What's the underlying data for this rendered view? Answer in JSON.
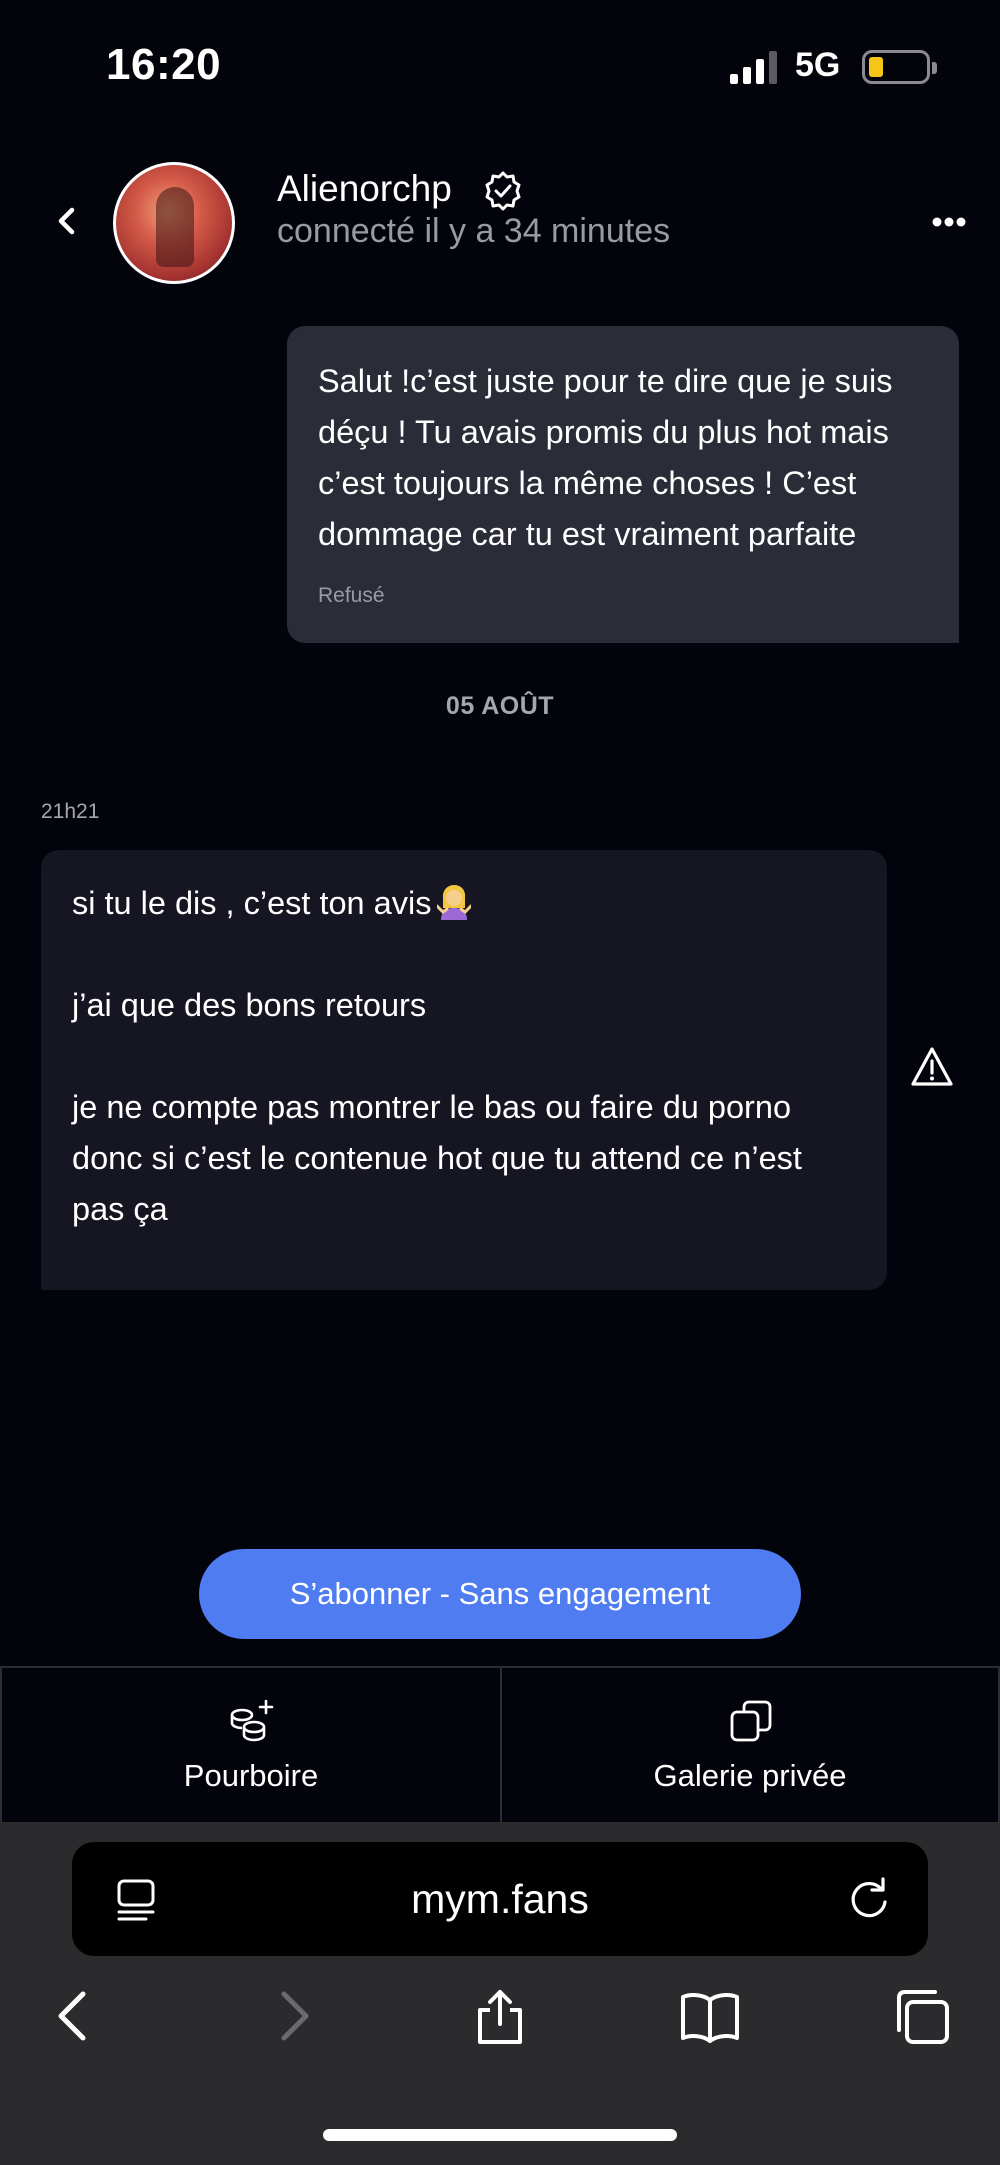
{
  "status_bar": {
    "time": "16:20",
    "network": "5G"
  },
  "header": {
    "username": "Alienorchp",
    "presence": "connecté il y a 34 minutes"
  },
  "messages": {
    "outgoing": {
      "text": "Salut !c’est juste pour te dire que je suis\ndéçu ! Tu avais promis du plus hot mais\nc’est toujours la même choses ! C’est\ndommage car tu est vraiment parfaite",
      "status": "Refusé"
    },
    "date_separator": "05 AOÛT",
    "incoming": {
      "time": "21h21",
      "line1": "si tu le dis , c’est ton avis",
      "line2": "j’ai que des bons retours",
      "line3": "je ne compte pas montrer le bas ou faire du porno donc si c’est le contenue hot que tu attend ce n’est pas ça"
    }
  },
  "subscribe_button": "S’abonner - Sans engagement",
  "actions": {
    "tip": "Pourboire",
    "gallery": "Galerie privée"
  },
  "browser": {
    "url": "mym.fans"
  },
  "icons": {
    "back": "chevron-left-icon",
    "verified": "verified-badge-icon",
    "more": "more-horizontal-icon",
    "report": "warning-triangle-icon",
    "tip": "coins-plus-icon",
    "gallery": "copy-stack-icon",
    "page": "reader-icon",
    "reload": "reload-icon",
    "share": "share-icon",
    "bookmarks": "book-icon",
    "tabs": "tabs-icon"
  },
  "colors": {
    "background": "#03040b",
    "accent": "#4f7cf0",
    "outgoing_bubble": "#2a2c37",
    "incoming_bubble": "#151622",
    "battery": "#f5c518"
  }
}
